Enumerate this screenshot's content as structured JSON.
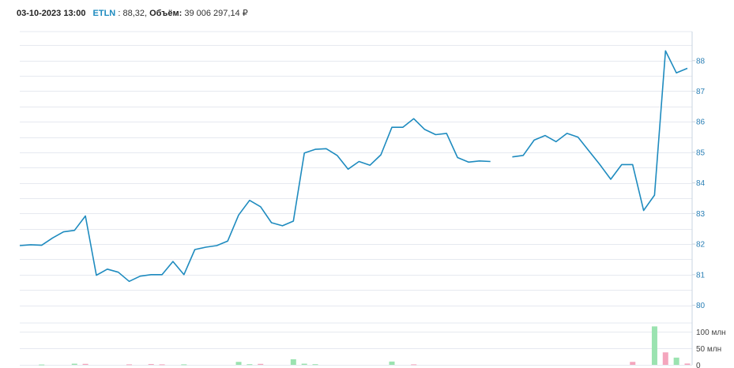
{
  "legend": {
    "datetime": "03-10-2023 13:00",
    "ticker": "ETLN",
    "price": "88,32,",
    "volume_label": "Объём:",
    "volume_value": "39 006 297,14 ₽"
  },
  "colors": {
    "line": "#1e8bbf",
    "grid": "#e6e9f0",
    "axis_text": "#2a7fb5",
    "vol_axis_text": "#444444",
    "vol_up": "#9be3b0",
    "vol_down": "#f4a6bd"
  },
  "chart_data": [
    {
      "type": "line",
      "series": [
        {
          "values": [
            81.95,
            81.98,
            81.96,
            82.2,
            82.4,
            82.45,
            82.92,
            80.98,
            81.18,
            81.08,
            80.78,
            80.95,
            81.0,
            81.0,
            81.43,
            81.0,
            81.82,
            81.9,
            81.95,
            82.1,
            82.95,
            83.43,
            83.22,
            82.7,
            82.6,
            82.75,
            84.98,
            85.1,
            85.12,
            84.9,
            84.45,
            84.7,
            84.58,
            84.92,
            85.82,
            85.82,
            86.1,
            85.75,
            85.58,
            85.62,
            84.83,
            84.68,
            84.72,
            84.7,
            null,
            84.85,
            84.9,
            85.4,
            85.55,
            85.35,
            85.62,
            85.5,
            85.05,
            84.6,
            84.12,
            84.6,
            84.6,
            83.1,
            83.6,
            88.32,
            87.6,
            87.75
          ]
        }
      ],
      "y_ticks": [
        "80",
        "81",
        "82",
        "83",
        "84",
        "85",
        "86",
        "87",
        "88"
      ],
      "ylim": [
        79.6,
        88.95
      ],
      "grid": true,
      "y_axis_position": "right"
    },
    {
      "type": "bar",
      "series": [
        {
          "values": [
            0,
            0,
            1.0,
            0,
            0,
            3.5,
            3.0,
            0,
            0,
            0,
            1.5,
            0,
            2.5,
            1.5,
            0,
            1.5,
            0,
            0,
            0,
            0,
            9.0,
            2.0,
            3.0,
            0,
            0,
            17.0,
            3.5,
            2.0,
            0,
            0,
            0,
            0,
            0,
            0,
            10.0,
            0,
            1.5,
            0,
            0,
            0,
            0,
            0,
            0,
            0,
            0,
            0,
            0,
            0,
            0,
            0,
            0,
            0,
            0,
            0,
            0,
            0,
            9.0,
            0,
            117.0,
            38.0,
            22.0,
            4.0
          ],
          "directions": [
            "up",
            "up",
            "up",
            "up",
            "up",
            "up",
            "down",
            "up",
            "up",
            "up",
            "down",
            "up",
            "down",
            "down",
            "up",
            "up",
            "up",
            "up",
            "up",
            "up",
            "up",
            "up",
            "down",
            "up",
            "up",
            "up",
            "up",
            "up",
            "up",
            "up",
            "up",
            "up",
            "up",
            "up",
            "up",
            "up",
            "down",
            "up",
            "up",
            "up",
            "up",
            "up",
            "up",
            "up",
            "up",
            "up",
            "up",
            "up",
            "up",
            "up",
            "up",
            "up",
            "up",
            "up",
            "up",
            "up",
            "down",
            "up",
            "up",
            "down",
            "up",
            "down"
          ]
        }
      ],
      "y_ticks": [
        "0",
        "50 млн",
        "100 млн"
      ],
      "ylim": [
        0,
        125
      ]
    }
  ]
}
